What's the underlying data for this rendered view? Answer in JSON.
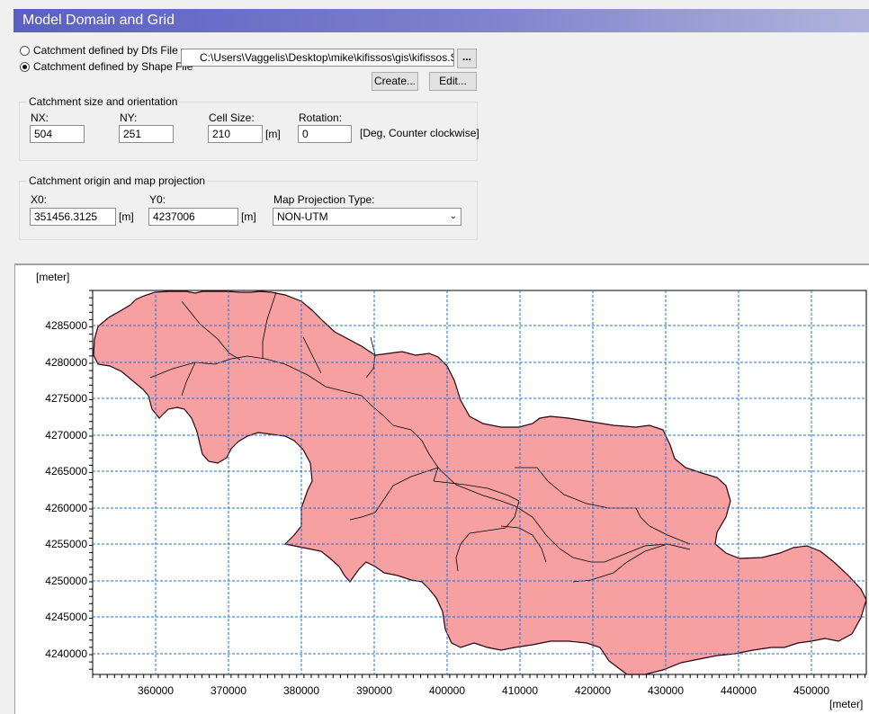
{
  "window": {
    "title": "Model Domain and Grid"
  },
  "source": {
    "option_dfs": "Catchment defined by Dfs File",
    "option_shape": "Catchment defined by Shape File",
    "selected": "shape",
    "file_path": "C:\\Users\\Vaggelis\\Desktop\\mike\\kifissos\\gis\\kifissos.SHP",
    "browse_label": "...",
    "create_label": "Create...",
    "edit_label": "Edit..."
  },
  "size_group": {
    "title": "Catchment size and orientation",
    "nx_label": "NX:",
    "nx_value": "504",
    "ny_label": "NY:",
    "ny_value": "251",
    "cell_label": "Cell Size:",
    "cell_value": "210",
    "cell_unit": "[m]",
    "rotation_label": "Rotation:",
    "rotation_value": "0",
    "rotation_unit": "[Deg, Counter clockwise]"
  },
  "origin_group": {
    "title": "Catchment origin and map projection",
    "x0_label": "X0:",
    "x0_value": "351456.3125",
    "x0_unit": "[m]",
    "y0_label": "Y0:",
    "y0_value": "4237006",
    "y0_unit": "[m]",
    "proj_label": "Map Projection Type:",
    "proj_value": "NON-UTM"
  },
  "map": {
    "y_unit": "[meter]",
    "x_unit": "[meter]",
    "x_ticks": [
      "360000",
      "370000",
      "380000",
      "390000",
      "400000",
      "410000",
      "420000",
      "430000",
      "440000",
      "450000"
    ],
    "y_ticks": [
      "4285000",
      "4280000",
      "4275000",
      "4270000",
      "4265000",
      "4260000",
      "4255000",
      "4250000",
      "4245000",
      "4240000"
    ],
    "fill_color": "#f6a0a2",
    "outline_color": "#2a0010",
    "grid_color": "#1f6fd6"
  }
}
